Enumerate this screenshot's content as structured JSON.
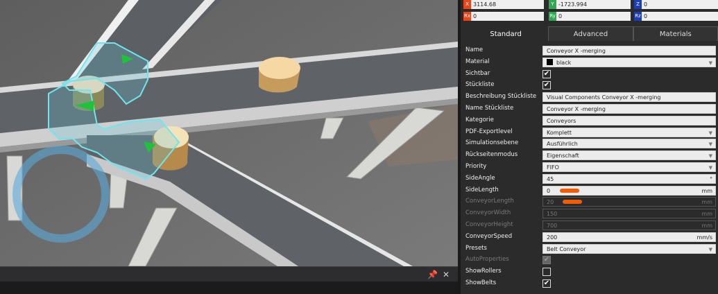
{
  "coords": {
    "x": {
      "tag": "X",
      "value": "3114.68",
      "color": "#e8461c"
    },
    "y": {
      "tag": "Y",
      "value": "-1723.994",
      "color": "#2fa84f"
    },
    "z": {
      "tag": "Z",
      "value": "0",
      "color": "#1c3fb8"
    },
    "rx": {
      "tag": "Rx",
      "value": "0",
      "color": "#e8461c"
    },
    "ry": {
      "tag": "Ry",
      "value": "0",
      "color": "#2fa84f"
    },
    "rz": {
      "tag": "Rz",
      "value": "0",
      "color": "#1c3fb8"
    }
  },
  "tabs": [
    "Standard",
    "Advanced",
    "Materials"
  ],
  "props": {
    "name": {
      "label": "Name",
      "value": "Conveyor X -merging"
    },
    "material": {
      "label": "Material",
      "value": "black"
    },
    "sichtbar": {
      "label": "Sichtbar",
      "checked": true
    },
    "stueckliste": {
      "label": "Stückliste",
      "checked": true
    },
    "beschreibung": {
      "label": "Beschreibung Stückliste",
      "value": "Visual Components Conveyor X -merging"
    },
    "name_stueckliste": {
      "label": "Name Stückliste",
      "value": "Conveyor X -merging"
    },
    "kategorie": {
      "label": "Kategorie",
      "value": "Conveyors"
    },
    "pdf": {
      "label": "PDF-Exportlevel",
      "value": "Komplett"
    },
    "simulation": {
      "label": "Simulationsebene",
      "value": "Ausführlich"
    },
    "rueckseiten": {
      "label": "Rückseitenmodus",
      "value": "Eigenschaft"
    },
    "priority": {
      "label": "Priority",
      "value": "FIFO"
    },
    "side_angle": {
      "label": "SideAngle",
      "value": "45",
      "unit": "°"
    },
    "side_length": {
      "label": "SideLength",
      "value": "0",
      "unit": "mm"
    },
    "conv_length": {
      "label": "ConveyorLength",
      "value": "20",
      "unit": "mm"
    },
    "conv_width": {
      "label": "ConveyorWidth",
      "value": "150",
      "unit": "mm"
    },
    "conv_height": {
      "label": "ConveyorHeight",
      "value": "700",
      "unit": "mm"
    },
    "conv_speed": {
      "label": "ConveyorSpeed",
      "value": "200",
      "unit": "mm/s"
    },
    "presets": {
      "label": "Presets",
      "value": "Belt Conveyor"
    },
    "auto": {
      "label": "AutoProperties",
      "checked": true
    },
    "rollers": {
      "label": "ShowRollers",
      "checked": false
    },
    "belts": {
      "label": "ShowBelts",
      "checked": true
    }
  },
  "icons": {
    "pin": "pin-icon",
    "close": "close-icon",
    "check": "✔",
    "dropdown": "▼"
  }
}
